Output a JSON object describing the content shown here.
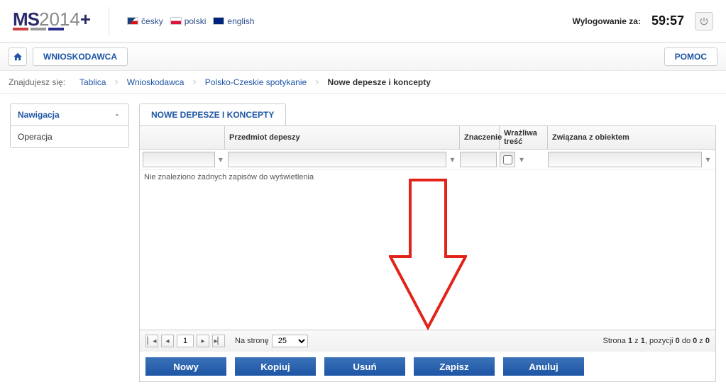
{
  "logo": {
    "ms": "MS",
    "year": "2014",
    "plus": "+"
  },
  "languages": [
    {
      "name": "česky"
    },
    {
      "name": "polski"
    },
    {
      "name": "english"
    }
  ],
  "session": {
    "label": "Wylogowanie za:",
    "time": "59:57"
  },
  "toolbar": {
    "tab": "WNIOSKODAWCA",
    "help": "POMOC"
  },
  "breadcrumb": {
    "label": "Znajdujesz się:",
    "items": [
      "Tablica",
      "Wnioskodawca",
      "Polsko-Czeskie spotykanie"
    ],
    "current": "Nowe depesze i koncepty"
  },
  "sidebar": {
    "nav_header": "Nawigacja",
    "items": [
      {
        "label": "Operacja"
      }
    ]
  },
  "page": {
    "tab_title": "NOWE DEPESZE I KONCEPTY"
  },
  "grid": {
    "columns": {
      "col1": "",
      "col2": "Przedmiot depeszy",
      "col3": "Znaczenie",
      "col4": "Wrażliwa treść",
      "col5": "Związana z obiektem"
    },
    "empty": "Nie znaleziono żadnych zapisów do wyświetlenia"
  },
  "pager": {
    "page": "1",
    "per_page_label": "Na stronę",
    "per_page_value": "25",
    "status_prefix": "Strona ",
    "status_mid": " z ",
    "status_pos": ", pozycji ",
    "status_to": " do ",
    "status_of": " z ",
    "p1": "1",
    "p2": "1",
    "r0": "0",
    "r1": "0",
    "r2": "0"
  },
  "actions": {
    "new": "Nowy",
    "copy": "Kopiuj",
    "delete": "Usuń",
    "save": "Zapisz",
    "cancel": "Anuluj"
  }
}
